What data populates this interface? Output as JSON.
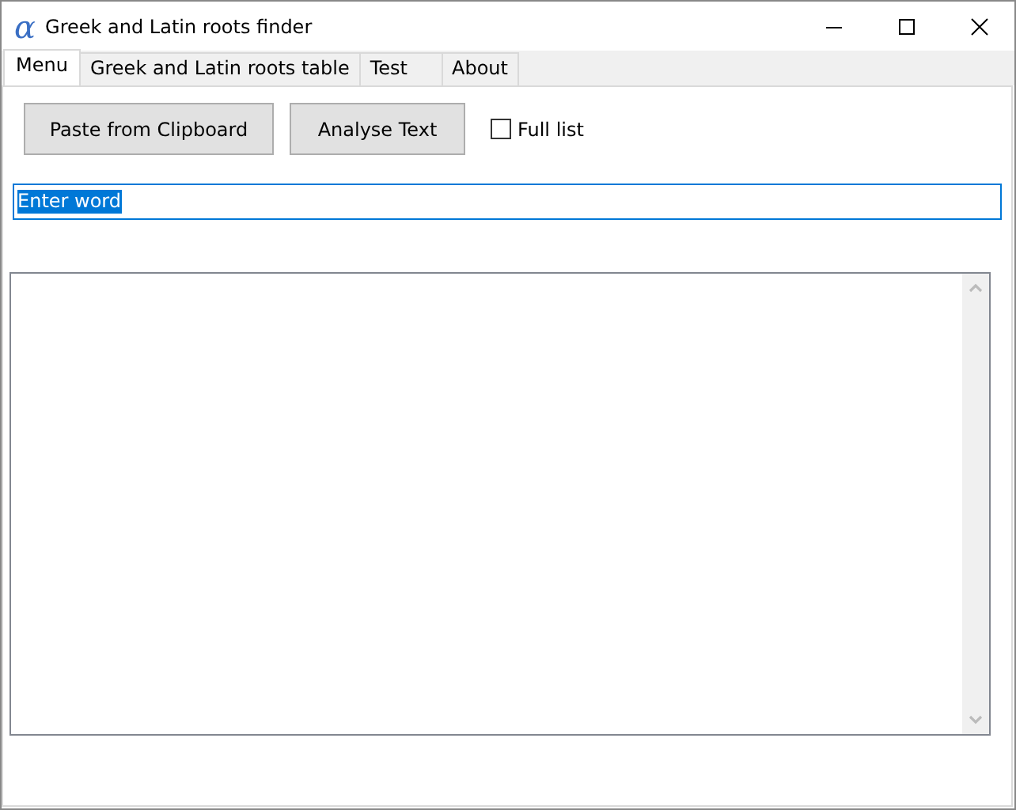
{
  "window": {
    "logo": "α",
    "title": "Greek and Latin roots finder"
  },
  "tabs": [
    {
      "label": "Menu",
      "selected": true
    },
    {
      "label": "Greek and Latin roots table",
      "selected": false
    },
    {
      "label": "Test",
      "selected": false
    },
    {
      "label": "About",
      "selected": false
    }
  ],
  "buttons": [
    "Paste from Clipboard",
    "Analyse Text"
  ],
  "full_list": {
    "label": "Full list",
    "checked": false
  },
  "word_field": {
    "value": "Enter word",
    "value_selected": true
  }
}
